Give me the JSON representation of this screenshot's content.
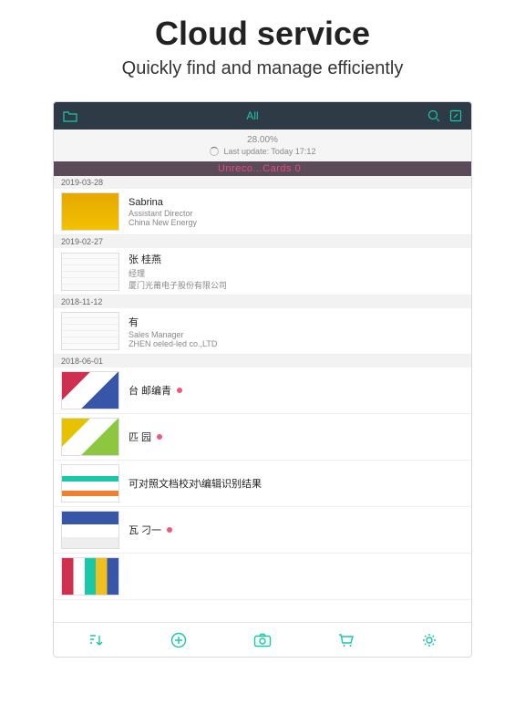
{
  "promo": {
    "title": "Cloud service",
    "subtitle": "Quickly find and manage efficiently"
  },
  "topbar": {
    "title": "All"
  },
  "sync": {
    "percent": "28.00%",
    "update": "Last update:  Today  17:12"
  },
  "unreco": "Unreco...Cards  0",
  "groups": [
    {
      "date": "2019-03-28",
      "cards": [
        {
          "name": "Sabrina",
          "role": "Assistant Director",
          "company": "China New Energy",
          "thumb": "t-yellow",
          "dot": false
        }
      ]
    },
    {
      "date": "2019-02-27",
      "cards": [
        {
          "name": "张 桂燕",
          "role": "经理",
          "company": "厦门光莆电子股份有限公司",
          "thumb": "t-card",
          "dot": false
        }
      ]
    },
    {
      "date": "2018-11-12",
      "cards": [
        {
          "name": "有",
          "role": "Sales Manager",
          "company": "ZHEN oeled-led co.,LTD",
          "thumb": "t-card",
          "dot": false
        }
      ]
    },
    {
      "date": "2018-06-01",
      "cards": [
        {
          "name": "台 邮编青",
          "role": "",
          "company": "",
          "thumb": "t-color1",
          "dot": true
        },
        {
          "name": "匹 园",
          "role": "",
          "company": "",
          "thumb": "t-color2",
          "dot": true
        },
        {
          "name": "可对照文档校对\\编辑识别结果",
          "role": "",
          "company": "",
          "thumb": "t-color3",
          "dot": false
        },
        {
          "name": "瓦 刁一",
          "role": "",
          "company": "",
          "thumb": "t-color4",
          "dot": true
        },
        {
          "name": "",
          "role": "",
          "company": "",
          "thumb": "t-color5",
          "dot": false
        }
      ]
    }
  ]
}
